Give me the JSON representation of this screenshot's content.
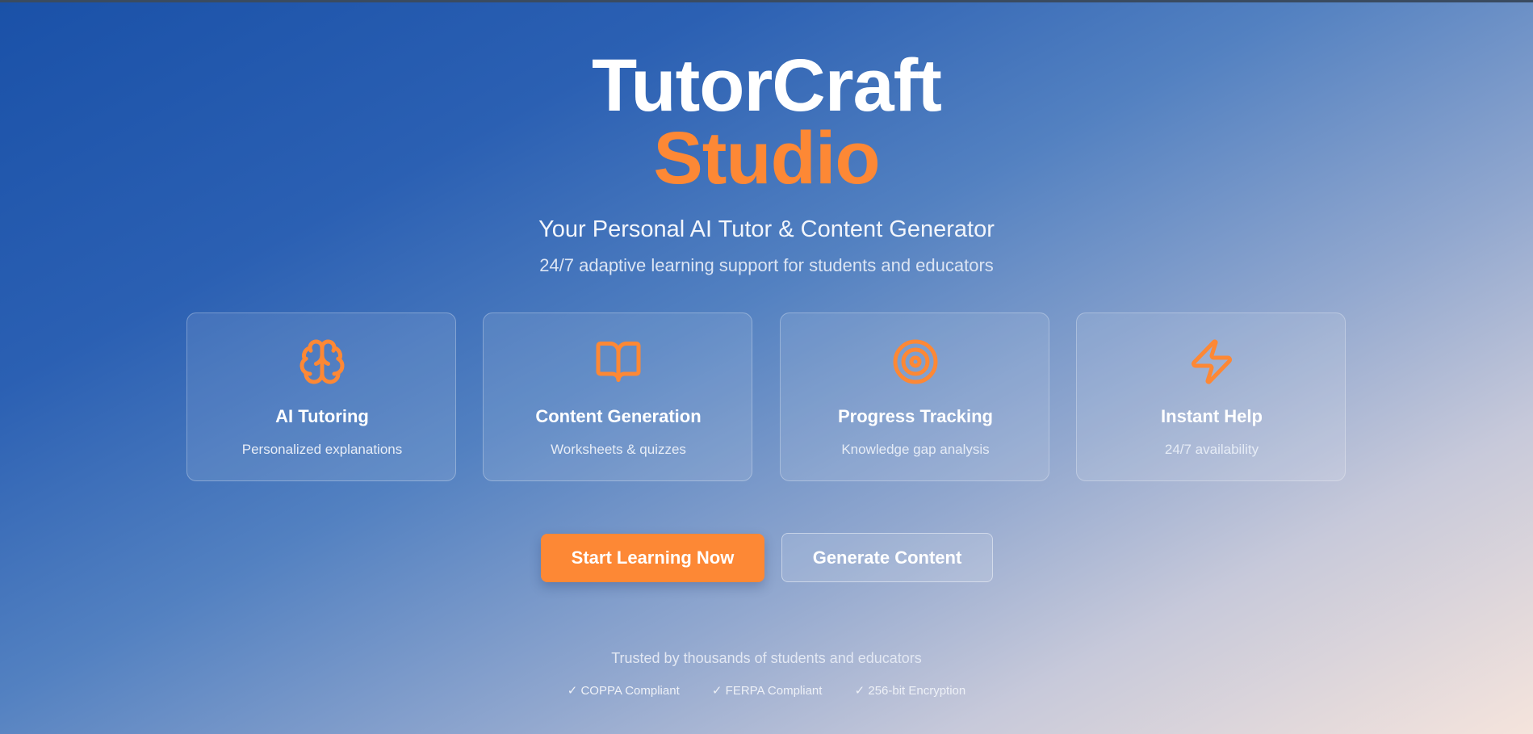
{
  "brand": {
    "title_line1": "TutorCraft",
    "title_line2": "Studio",
    "accent_color": "#fd8835"
  },
  "hero": {
    "tagline": "Your Personal AI Tutor & Content Generator",
    "subtagline": "24/7 adaptive learning support for students and educators"
  },
  "features": [
    {
      "icon": "brain-icon",
      "title": "AI Tutoring",
      "description": "Personalized explanations"
    },
    {
      "icon": "book-icon",
      "title": "Content Generation",
      "description": "Worksheets & quizzes"
    },
    {
      "icon": "target-icon",
      "title": "Progress Tracking",
      "description": "Knowledge gap analysis"
    },
    {
      "icon": "lightning-icon",
      "title": "Instant Help",
      "description": "24/7 availability"
    }
  ],
  "actions": {
    "primary_label": "Start Learning Now",
    "secondary_label": "Generate Content"
  },
  "footer": {
    "trusted_text": "Trusted by thousands of students and educators",
    "badges": [
      "✓ COPPA Compliant",
      "✓ FERPA Compliant",
      "✓ 256-bit Encryption"
    ]
  }
}
